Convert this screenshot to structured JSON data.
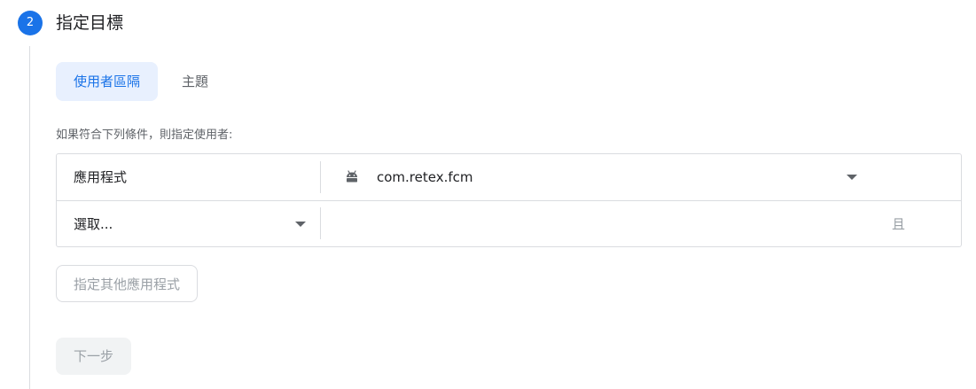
{
  "step": {
    "number": "2",
    "title": "指定目標"
  },
  "tabs": [
    {
      "label": "使用者區隔",
      "active": true
    },
    {
      "label": "主題",
      "active": false
    }
  ],
  "condition_text": "如果符合下列條件，則指定使用者:",
  "targeting": {
    "rows": [
      {
        "label": "應用程式",
        "value": "com.retex.fcm",
        "icon": "android-icon"
      },
      {
        "label": "選取...",
        "and_label": "且"
      }
    ]
  },
  "buttons": {
    "add_app": "指定其他應用程式",
    "next": "下一步"
  },
  "colors": {
    "accent": "#1a73e8",
    "tab_active_bg": "#e8f0fe",
    "disabled_text": "#9aa0a6",
    "border": "#dadce0"
  }
}
